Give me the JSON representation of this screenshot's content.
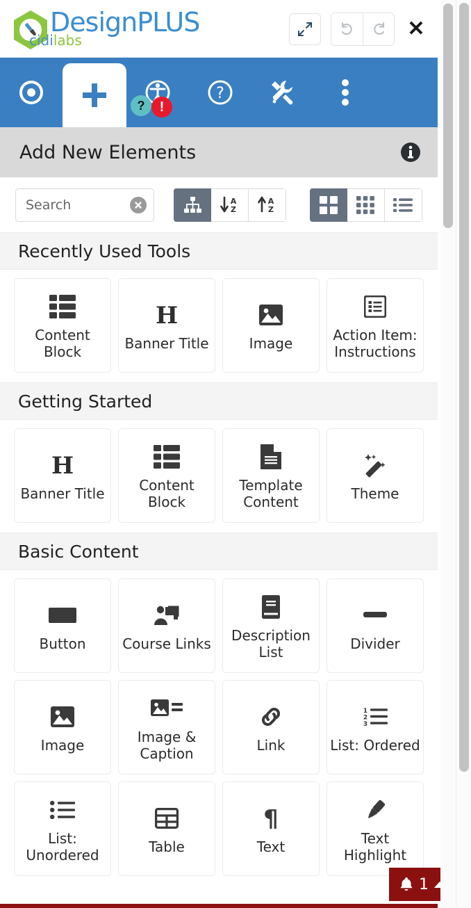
{
  "brand": {
    "title": "DesignPLUS",
    "sub_primary": "cidi",
    "sub_secondary": "labs",
    "blue": "#3b8ed0",
    "green": "#8cc63e"
  },
  "header_actions": {
    "expand_label": "expand-icon",
    "undo_label": "undo-icon",
    "redo_label": "redo-icon",
    "close_label": "✕"
  },
  "tabs": [
    {
      "name": "target",
      "icon": "bullseye-icon",
      "active": false
    },
    {
      "name": "add",
      "icon": "plus-icon",
      "active": true
    },
    {
      "name": "accessibility",
      "icon": "accessibility-icon",
      "active": false,
      "badges": [
        "?",
        "!"
      ]
    },
    {
      "name": "help",
      "icon": "question-circle-icon",
      "active": false
    },
    {
      "name": "tools",
      "icon": "tools-icon",
      "active": false
    },
    {
      "name": "more",
      "icon": "kebab-menu-icon",
      "active": false
    }
  ],
  "page": {
    "title": "Add New Elements",
    "info_icon": "info-circle-icon"
  },
  "toolbar": {
    "search_placeholder": "Search",
    "search_value": "",
    "clear_icon": "clear-circle-icon",
    "sort_buttons": [
      {
        "name": "sitemap",
        "icon": "sitemap-icon",
        "active": true
      },
      {
        "name": "sort-alpha-down",
        "icon": "sort-alpha-down-icon",
        "active": false
      },
      {
        "name": "sort-alpha-up",
        "icon": "sort-alpha-up-icon",
        "active": false
      }
    ],
    "view_buttons": [
      {
        "name": "grid-large",
        "icon": "grid-large-icon",
        "active": true
      },
      {
        "name": "grid-small",
        "icon": "grid-small-icon",
        "active": false
      },
      {
        "name": "list-view",
        "icon": "list-view-icon",
        "active": false
      }
    ]
  },
  "sections": [
    {
      "title": "Recently Used Tools",
      "items": [
        {
          "label": "Content Block",
          "icon": "content-block-icon"
        },
        {
          "label": "Banner Title",
          "icon": "heading-h-icon"
        },
        {
          "label": "Image",
          "icon": "image-icon"
        },
        {
          "label": "Action Item: Instructions",
          "icon": "action-item-icon"
        }
      ]
    },
    {
      "title": "Getting Started",
      "items": [
        {
          "label": "Banner Title",
          "icon": "heading-h-icon"
        },
        {
          "label": "Content Block",
          "icon": "content-block-icon"
        },
        {
          "label": "Template Content",
          "icon": "document-icon"
        },
        {
          "label": "Theme",
          "icon": "magic-wand-icon"
        }
      ]
    },
    {
      "title": "Basic Content",
      "items": [
        {
          "label": "Button",
          "icon": "button-icon"
        },
        {
          "label": "Course Links",
          "icon": "course-links-icon"
        },
        {
          "label": "Description List",
          "icon": "book-icon"
        },
        {
          "label": "Divider",
          "icon": "divider-icon"
        },
        {
          "label": "Image",
          "icon": "image-icon"
        },
        {
          "label": "Image & Caption",
          "icon": "image-caption-icon"
        },
        {
          "label": "Link",
          "icon": "link-icon"
        },
        {
          "label": "List: Ordered",
          "icon": "list-ordered-icon"
        },
        {
          "label": "List: Unordered",
          "icon": "list-unordered-icon"
        },
        {
          "label": "Table",
          "icon": "table-icon"
        },
        {
          "label": "Text",
          "icon": "paragraph-icon"
        },
        {
          "label": "Text Highlight",
          "icon": "highlighter-icon"
        }
      ]
    }
  ],
  "notification": {
    "icon": "bell-icon",
    "count": "1",
    "caret": "caret-up-icon",
    "color": "#8b1111"
  }
}
